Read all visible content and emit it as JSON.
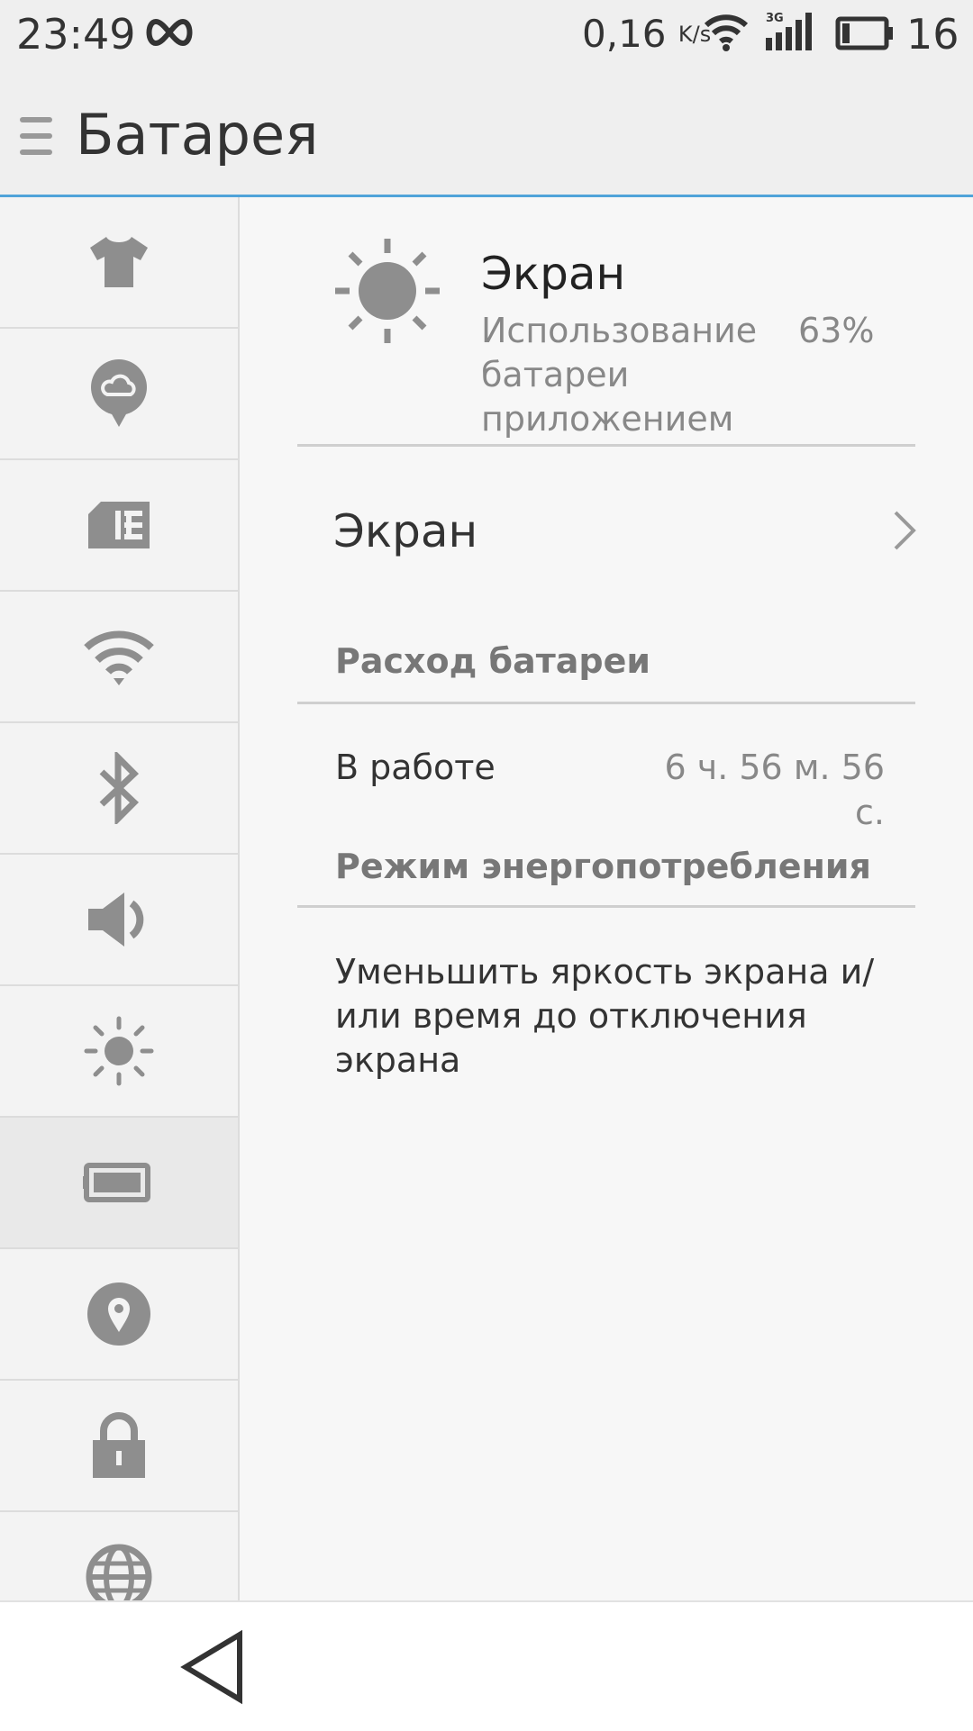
{
  "status_bar": {
    "time": "23:49",
    "net_speed": "0,16",
    "net_unit": "K/s",
    "signal_type": "3G",
    "battery_level": "16"
  },
  "header": {
    "title": "Батарея"
  },
  "sidebar": {
    "items": [
      {
        "icon": "tshirt-icon"
      },
      {
        "icon": "cloud-icon"
      },
      {
        "icon": "sim-card-icon"
      },
      {
        "icon": "wifi-icon"
      },
      {
        "icon": "bluetooth-icon"
      },
      {
        "icon": "speaker-icon"
      },
      {
        "icon": "brightness-icon"
      },
      {
        "icon": "battery-icon",
        "active": true
      },
      {
        "icon": "location-icon"
      },
      {
        "icon": "lock-icon"
      },
      {
        "icon": "globe-icon"
      }
    ]
  },
  "app": {
    "icon": "sun-icon",
    "name": "Экран",
    "usage_label": "Использование батареи приложением",
    "usage_value": "63%"
  },
  "screen_row": {
    "label": "Экран"
  },
  "battery_usage": {
    "section_title": "Расход батареи",
    "work_label": "В работе",
    "work_value": "6 ч. 56 м. 56 с."
  },
  "power_mode": {
    "section_title": "Режим энергопотребления",
    "tip": "Уменьшить яркость экрана и/или время до отключения экрана"
  },
  "colors": {
    "accent": "#4fa3d9",
    "icon_gray": "#8e8e8e"
  }
}
